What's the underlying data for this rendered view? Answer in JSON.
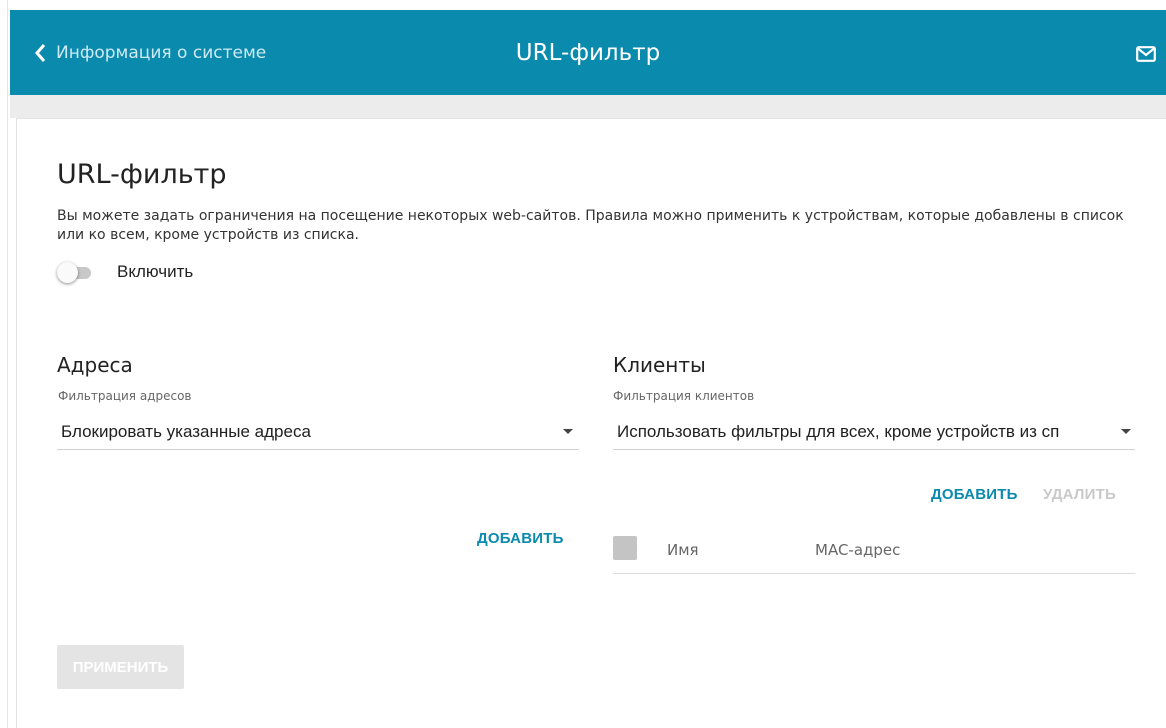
{
  "header": {
    "back_label": "Информация о системе",
    "title": "URL-фильтр",
    "back_icon": "chevron-left-icon",
    "mail_icon": "mail-icon",
    "color": "#0a8aad"
  },
  "page": {
    "title": "URL-фильтр",
    "description": "Вы можете задать ограничения на посещение некоторых web-сайтов. Правила можно применить к устройствам, которые добавлены в список или ко всем, кроме устройств из списка.",
    "enable_label": "Включить",
    "enable_state": false
  },
  "addresses": {
    "title": "Адреса",
    "filter_label": "Фильтрация адресов",
    "filter_value": "Блокировать указанные адреса",
    "add_label": "ДОБАВИТЬ"
  },
  "clients": {
    "title": "Клиенты",
    "filter_label": "Фильтрация клиентов",
    "filter_value": "Использовать фильтры для всех, кроме устройств из сп",
    "add_label": "ДОБАВИТЬ",
    "delete_label": "УДАЛИТЬ",
    "columns": [
      "Имя",
      "MAC-адрес"
    ]
  },
  "actions": {
    "apply_label": "ПРИМЕНИТЬ"
  }
}
